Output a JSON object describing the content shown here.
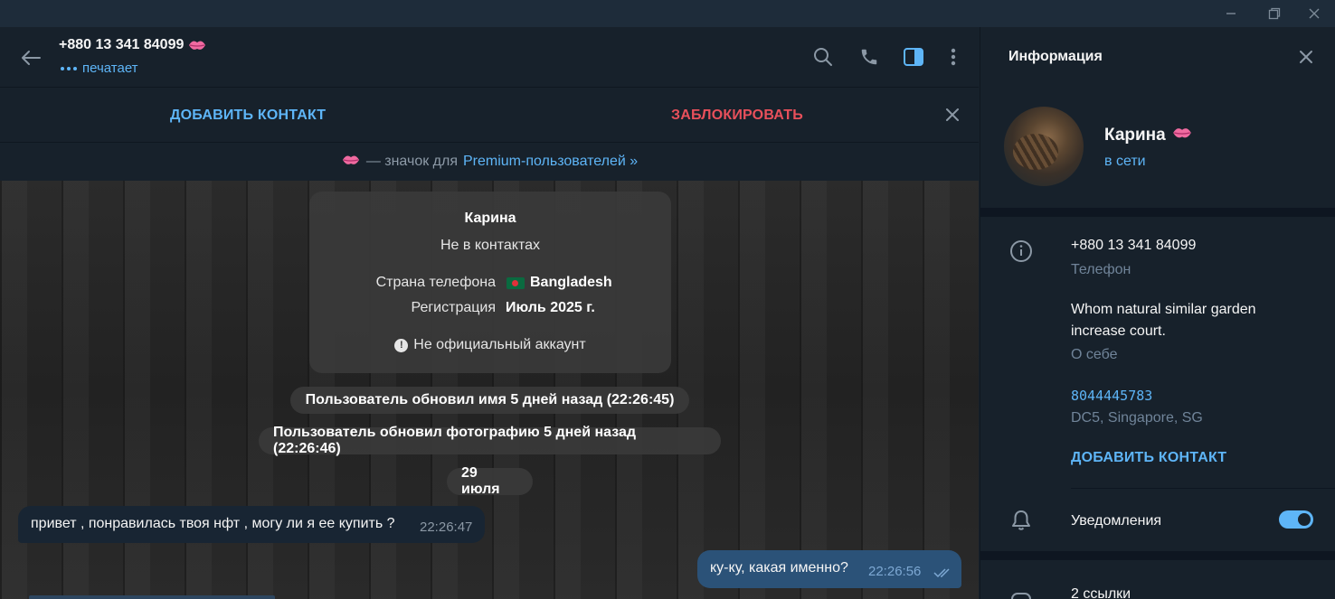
{
  "colors": {
    "accent": "#5eb5f7",
    "danger": "#e8505b",
    "panel_bg": "#17212b",
    "outgoing_bubble": "#2b5278",
    "incoming_bubble": "#182533"
  },
  "chat_header": {
    "title": "+880 13 341 84099",
    "status": "печатает",
    "icons": [
      "back-arrow-icon",
      "search-icon",
      "phone-icon",
      "sidebar-toggle-icon",
      "more-vertical-icon"
    ]
  },
  "action_bar": {
    "add_contact": "ДОБАВИТЬ КОНТАКТ",
    "block": "ЗАБЛОКИРОВАТЬ"
  },
  "premium_notice": {
    "text": "— значок для",
    "link": "Premium-пользователей »"
  },
  "info_card": {
    "name": "Карина",
    "subtitle": "Не в контактах",
    "country_label": "Страна телефона",
    "country_value": "Bangladesh",
    "registration_label": "Регистрация",
    "registration_value": "Июль 2025 г.",
    "unofficial": "Не официальный аккаунт"
  },
  "service_messages": [
    "Пользователь обновил имя 5 дней назад (22:26:45)",
    "Пользователь обновил фотографию 5 дней назад (22:26:46)"
  ],
  "date_separator": "29 июля",
  "messages": {
    "incoming": {
      "text": "привет , понравилась твоя нфт , могу ли я ее купить ?",
      "time": "22:26:47"
    },
    "outgoing": {
      "text": "ку-ку, какая именно?",
      "time": "22:26:56"
    }
  },
  "right_panel": {
    "title": "Информация",
    "name": "Карина",
    "status": "в сети",
    "phone": "+880 13 341 84099",
    "phone_label": "Телефон",
    "bio_line1": "Whom natural similar garden",
    "bio_line2": "increase court.",
    "bio_label": "О себе",
    "user_id": "8044445783",
    "dc": "DC5, Singapore, SG",
    "add_contact": "ДОБАВИТЬ КОНТАКТ",
    "notifications": "Уведомления",
    "notifications_on": true,
    "links": "2 ссылки"
  }
}
